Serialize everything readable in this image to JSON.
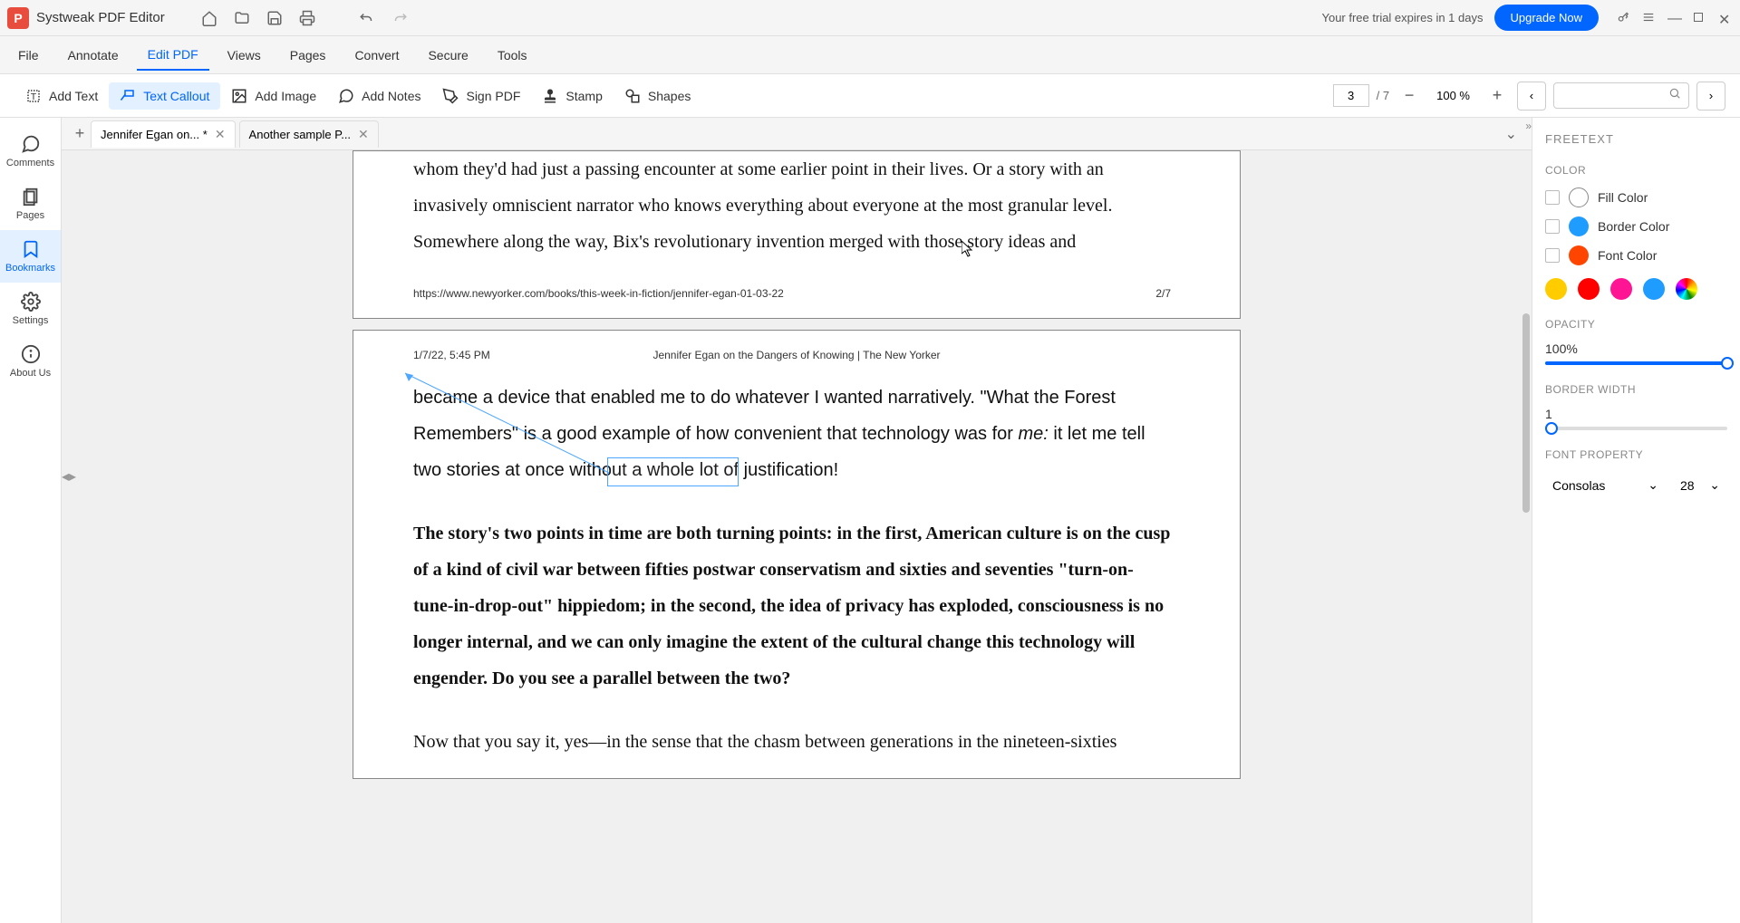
{
  "app": {
    "title": "Systweak PDF Editor",
    "trial": "Your free trial expires in 1 days",
    "upgrade": "Upgrade Now"
  },
  "menu": {
    "file": "File",
    "annotate": "Annotate",
    "edit_pdf": "Edit PDF",
    "views": "Views",
    "pages": "Pages",
    "convert": "Convert",
    "secure": "Secure",
    "tools": "Tools"
  },
  "tools": {
    "add_text": "Add Text",
    "text_callout": "Text Callout",
    "add_image": "Add Image",
    "add_notes": "Add Notes",
    "sign_pdf": "Sign PDF",
    "stamp": "Stamp",
    "shapes": "Shapes"
  },
  "page_nav": {
    "current": "3",
    "total": "/ 7",
    "zoom": "100 %"
  },
  "sidebar": {
    "comments": "Comments",
    "pages": "Pages",
    "bookmarks": "Bookmarks",
    "settings": "Settings",
    "about": "About Us"
  },
  "tabs": [
    {
      "label": "Jennifer Egan on... *"
    },
    {
      "label": "Another sample P..."
    }
  ],
  "doc": {
    "page2": {
      "body": "whom they'd had just a passing encounter at some earlier point in their lives. Or a story with an invasively omniscient narrator who knows everything about everyone at the most granular level. Somewhere along the way, Bix's revolutionary invention merged with those story ideas and",
      "url": "https://www.newyorker.com/books/this-week-in-fiction/jennifer-egan-01-03-22",
      "pagenum": "2/7"
    },
    "page3": {
      "header_left": "1/7/22, 5:45 PM",
      "header_center": "Jennifer Egan on the Dangers of Knowing | The New Yorker",
      "para1_a": "became a device that enabled me to do whatever I wanted narratively. \"What the Forest Remembers\" is a good example of how convenient that technology was for ",
      "para1_me": "me:",
      "para1_b": " it let me tell two stories at once without a whole lot of justification!",
      "para2": "The story's two points in time are both turning points: in the first, American culture is on the cusp of a kind of civil war between fifties postwar conservatism and sixties and seventies \"turn-on-tune-in-drop-out\" hippiedom; in the second, the idea of privacy has exploded, consciousness is no longer internal, and we can only imagine the extent of the cultural change this technology will engender. Do you see a parallel between the two?",
      "para3": "Now that you say it, yes—in the sense that the chasm between generations in the nineteen-sixties"
    }
  },
  "panel": {
    "title": "FREETEXT",
    "color_section": "COLOR",
    "fill": "Fill Color",
    "border": "Border Color",
    "font": "Font Color",
    "opacity_section": "OPACITY",
    "opacity_val": "100%",
    "border_width_section": "BORDER WIDTH",
    "border_width_val": "1",
    "font_section": "FONT PROPERTY",
    "font_name": "Consolas",
    "font_size": "28",
    "colors": {
      "fill_swatch": "#ffffff",
      "border_swatch": "#1e9cff",
      "font_swatch": "#ff4500",
      "palette": [
        "#ffcc00",
        "#ff0000",
        "#ff1493",
        "#1e9cff"
      ]
    }
  }
}
